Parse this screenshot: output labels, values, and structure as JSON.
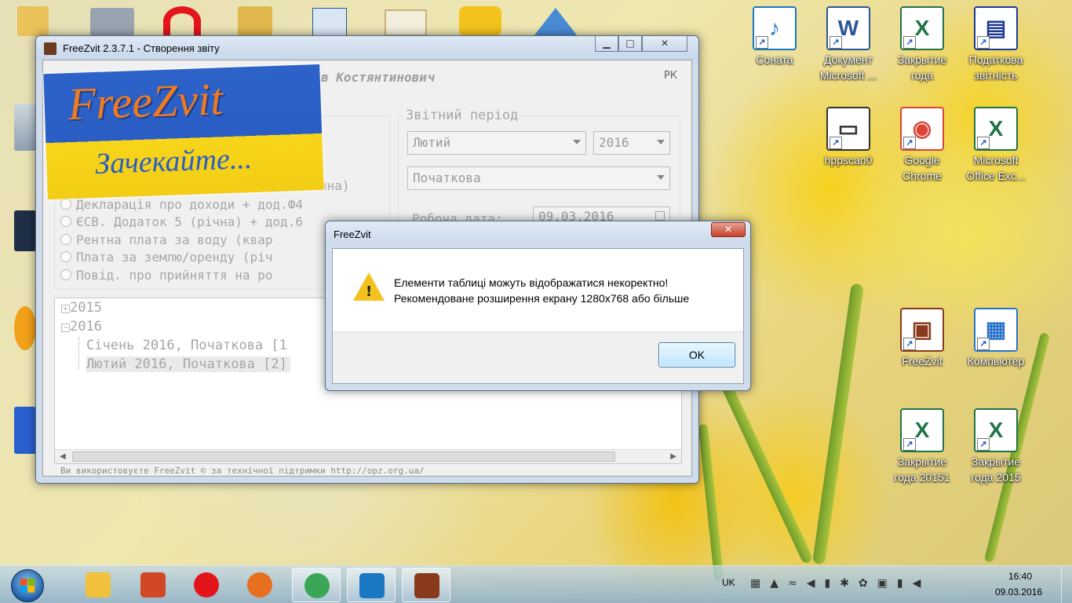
{
  "desktop": {
    "icons_right": [
      {
        "label": "Соната",
        "name": "sonata-icon",
        "color": "#1a78c2",
        "glyph": "♪"
      },
      {
        "label": "Документ Microsoft ...",
        "name": "word-document-icon",
        "color": "#2b5797",
        "glyph": "W"
      },
      {
        "label": "Закрытие года",
        "name": "excel-file-icon",
        "color": "#217346",
        "glyph": "X"
      },
      {
        "label": "Податкова звітність",
        "name": "tax-report-icon",
        "color": "#1f3a93",
        "glyph": "▤"
      },
      {
        "label": "hppscan0",
        "name": "scanner-icon",
        "color": "#333333",
        "glyph": "▭"
      },
      {
        "label": "Google Chrome",
        "name": "chrome-icon",
        "color": "#db4437",
        "glyph": "◉"
      },
      {
        "label": "Microsoft Office Exc...",
        "name": "excel-app-icon",
        "color": "#217346",
        "glyph": "X"
      },
      {
        "label": "FreeZvit",
        "name": "freezvit-desktop-icon",
        "color": "#8a3a1c",
        "glyph": "▣"
      },
      {
        "label": "Компьютер",
        "name": "computer-icon",
        "color": "#2a74c9",
        "glyph": "▦"
      },
      {
        "label": "Закрытие года 20151",
        "name": "excel-file-2015-1-icon",
        "color": "#217346",
        "glyph": "X"
      },
      {
        "label": "Закрытие года 2015",
        "name": "excel-file-2015-icon",
        "color": "#217346",
        "glyph": "X"
      }
    ]
  },
  "freezvit": {
    "title": "FreeZvit 2.3.7.1 - Створення звіту",
    "user_name": "в Костянтинович",
    "rk": "РК",
    "period_label": "Звітний період",
    "month": "Лютий",
    "year": "2016",
    "report_type": "Початкова",
    "work_date_label": "Робоча дата:",
    "work_date": "09.03.2016",
    "radio_items": [
      "Декларація про доходи + дод.Ф4",
      "ЄСВ. Додаток 5 (річна) + дод.6",
      "Рентна плата за воду (квар",
      "Плата за землю/оренду (річ",
      "Повід. про прийняття на ро"
    ],
    "partial_top": "чна)",
    "tree": {
      "y2015": "2015",
      "y2016": "2016",
      "child1": "Січень 2016, Початкова [1",
      "child2": "Лютий 2016, Початкова [2]"
    },
    "status_bar": "Ви використовуєте FreeZvit © за технічної підтримки http://opz.org.ua/",
    "splash_logo": "FreeZvit",
    "splash_wait": "Зачекайте..."
  },
  "dialog": {
    "title": "FreeZvit",
    "line1": "Елементи таблиці можуть відображатися некоректно!",
    "line2": "Рекомендоване розширення екрану 1280x768 або більше",
    "ok": "OK",
    "close": "✕"
  },
  "taskbar": {
    "lang": "UK",
    "time": "16:40",
    "date": "09.03.2016",
    "items": [
      {
        "name": "taskbar-explorer",
        "color": "#f2c13c",
        "open": false
      },
      {
        "name": "taskbar-powerpoint",
        "color": "#d24726",
        "open": false
      },
      {
        "name": "taskbar-opera",
        "color": "#e3141b",
        "open": false
      },
      {
        "name": "taskbar-firefox",
        "color": "#e76f1f",
        "open": false
      },
      {
        "name": "taskbar-chrome",
        "color": "#3aa757",
        "open": true
      },
      {
        "name": "taskbar-sonata",
        "color": "#1a78c2",
        "open": true
      },
      {
        "name": "taskbar-freezvit",
        "color": "#8a3a1c",
        "open": true
      }
    ]
  }
}
